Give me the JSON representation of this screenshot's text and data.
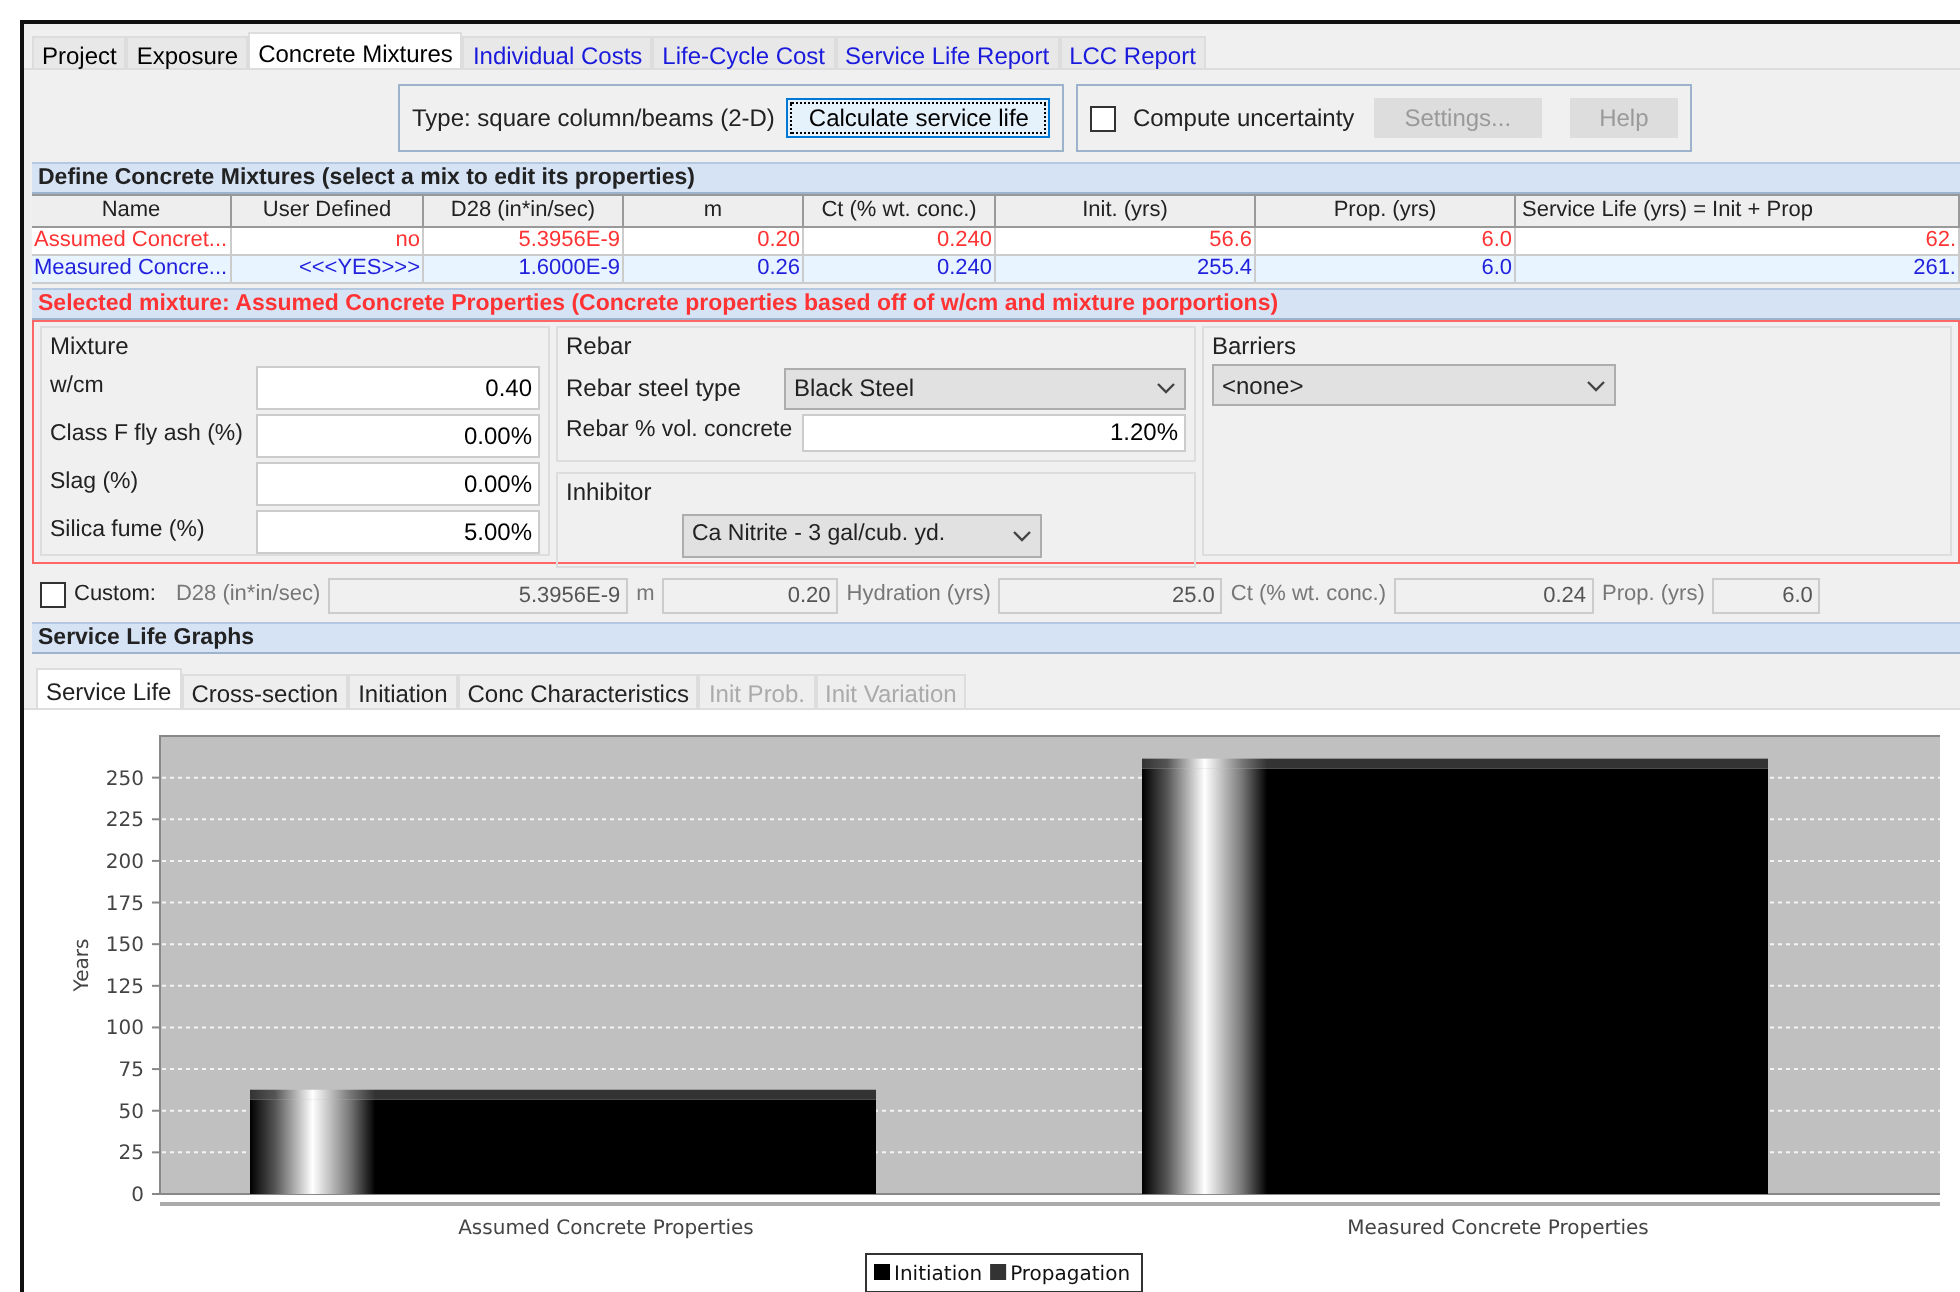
{
  "tabs": [
    {
      "label": "Project",
      "selected": false,
      "color": "#000000"
    },
    {
      "label": "Exposure",
      "selected": false,
      "color": "#000000"
    },
    {
      "label": "Concrete Mixtures",
      "selected": true,
      "color": "#000000"
    },
    {
      "label": "Individual Costs",
      "selected": false,
      "color": "#1a1adc"
    },
    {
      "label": "Life-Cycle Cost",
      "selected": false,
      "color": "#1a1adc"
    },
    {
      "label": "Service Life Report",
      "selected": false,
      "color": "#1a1adc"
    },
    {
      "label": "LCC Report",
      "selected": false,
      "color": "#1a1adc"
    }
  ],
  "toolbar": {
    "type_label": "Type: square column/beams (2-D)",
    "calculate_button": "Calculate service life",
    "uncertainty": {
      "label": "Compute uncertainty",
      "checked": false
    },
    "buttons": [
      {
        "label": "Settings...",
        "disabled": true
      },
      {
        "label": "Help",
        "disabled": true
      }
    ]
  },
  "mixtures": {
    "title": "Define Concrete Mixtures (select a mix to edit its properties)",
    "columns": [
      "Name",
      "User Defined",
      "D28 (in*in/sec)",
      "m",
      "Ct (% wt. conc.)",
      "Init. (yrs)",
      "Prop. (yrs)",
      "Service Life (yrs) = Init + Prop"
    ],
    "rows": [
      {
        "color": "#ff3333",
        "cells": [
          "Assumed Concret...",
          "no",
          "5.3956E-9",
          "0.20",
          "0.240",
          "56.6",
          "6.0",
          "62."
        ]
      },
      {
        "color": "#2222dd",
        "cells": [
          "Measured Concre...",
          "<<<YES>>>",
          "1.6000E-9",
          "0.26",
          "0.240",
          "255.4",
          "6.0",
          "261."
        ]
      }
    ]
  },
  "selected_mixture": {
    "title": "Selected mixture: Assumed Concrete Properties (Concrete properties based off of w/cm and mixture porportions)",
    "mixture": {
      "legend": "Mixture",
      "fields": [
        {
          "label": "w/cm",
          "value": "0.40"
        },
        {
          "label": "Class F fly ash (%)",
          "value": "0.00%"
        },
        {
          "label": "Slag (%)",
          "value": "0.00%"
        },
        {
          "label": "Silica fume (%)",
          "value": "5.00%"
        }
      ]
    },
    "rebar": {
      "legend": "Rebar",
      "steel_label": "Rebar steel type",
      "steel_value": "Black Steel",
      "percent_label": "Rebar % vol. concrete",
      "percent_value": "1.20%"
    },
    "inhibitor": {
      "legend": "Inhibitor",
      "value": "Ca Nitrite - 3 gal/cub. yd."
    },
    "barriers": {
      "legend": "Barriers",
      "value": "<none>"
    }
  },
  "custom": {
    "label": "Custom:",
    "checked": false,
    "fields": [
      {
        "label": "D28 (in*in/sec)",
        "value": "5.3956E-9"
      },
      {
        "label": "m",
        "value": "0.20"
      },
      {
        "label": "Hydration (yrs)",
        "value": "25.0"
      },
      {
        "label": "Ct (% wt. conc.)",
        "value": "0.24"
      },
      {
        "label": "Prop. (yrs)",
        "value": "6.0"
      }
    ]
  },
  "graphs": {
    "title": "Service Life Graphs",
    "tabs": [
      {
        "label": "Service Life",
        "selected": true,
        "disabled": false
      },
      {
        "label": "Cross-section",
        "selected": false,
        "disabled": false
      },
      {
        "label": "Initiation",
        "selected": false,
        "disabled": false
      },
      {
        "label": "Conc Characteristics",
        "selected": false,
        "disabled": false
      },
      {
        "label": "Init Prob.",
        "selected": false,
        "disabled": true
      },
      {
        "label": "Init Variation",
        "selected": false,
        "disabled": true
      }
    ],
    "chart_data": {
      "type": "bar",
      "stacked": true,
      "ylabel": "Years",
      "categories": [
        "Assumed Concrete Properties",
        "Measured Concrete Properties"
      ],
      "series": [
        {
          "name": "Initiation",
          "color": "#000000",
          "values": [
            56.6,
            255.4
          ]
        },
        {
          "name": "Propagation",
          "color": "#333333",
          "values": [
            6.0,
            6.0
          ]
        }
      ],
      "grid": true,
      "legend": "bottom",
      "ylim": [
        0,
        275
      ],
      "yticks": [
        0,
        25,
        50,
        75,
        100,
        125,
        150,
        175,
        200,
        225,
        250
      ]
    }
  }
}
